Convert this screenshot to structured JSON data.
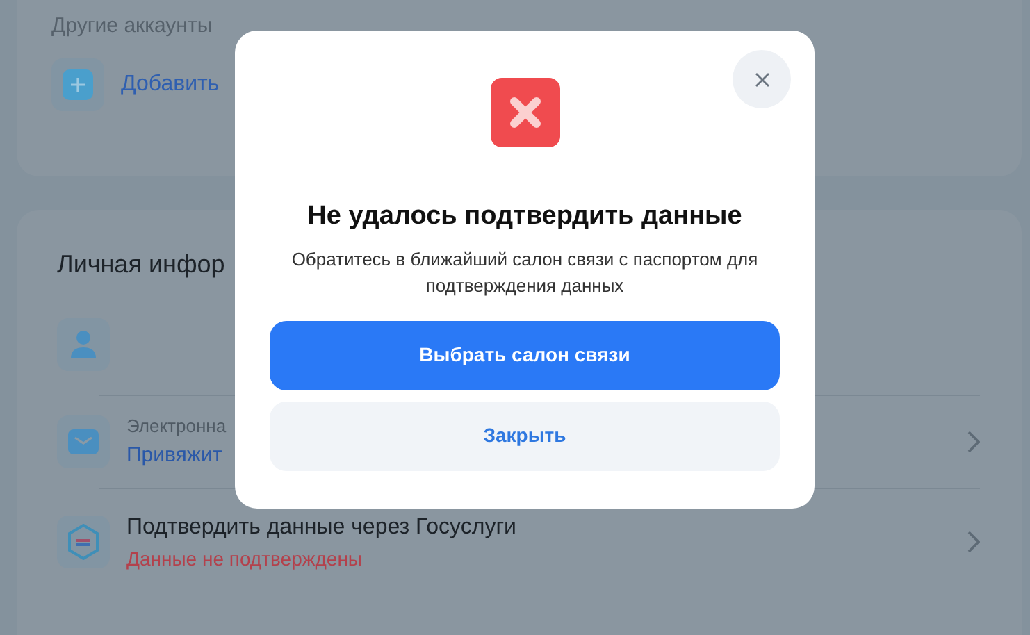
{
  "other_accounts": {
    "title": "Другие аккаунты",
    "add_label": "Добавить"
  },
  "personal_info": {
    "title": "Личная инфор",
    "rows": [
      {
        "kind": "profile"
      },
      {
        "kind": "email",
        "label": "Электронна",
        "link": "Привяжит"
      },
      {
        "kind": "gosuslugi",
        "label": "Подтвердить данные через Госуслуги",
        "status": "Данные не подтверждены"
      }
    ]
  },
  "dialog": {
    "title": "Не удалось подтвердить данные",
    "message": "Обратитесь в ближайший салон связи с паспортом для подтверждения данных",
    "primary_button": "Выбрать салон связи",
    "secondary_button": "Закрыть"
  }
}
